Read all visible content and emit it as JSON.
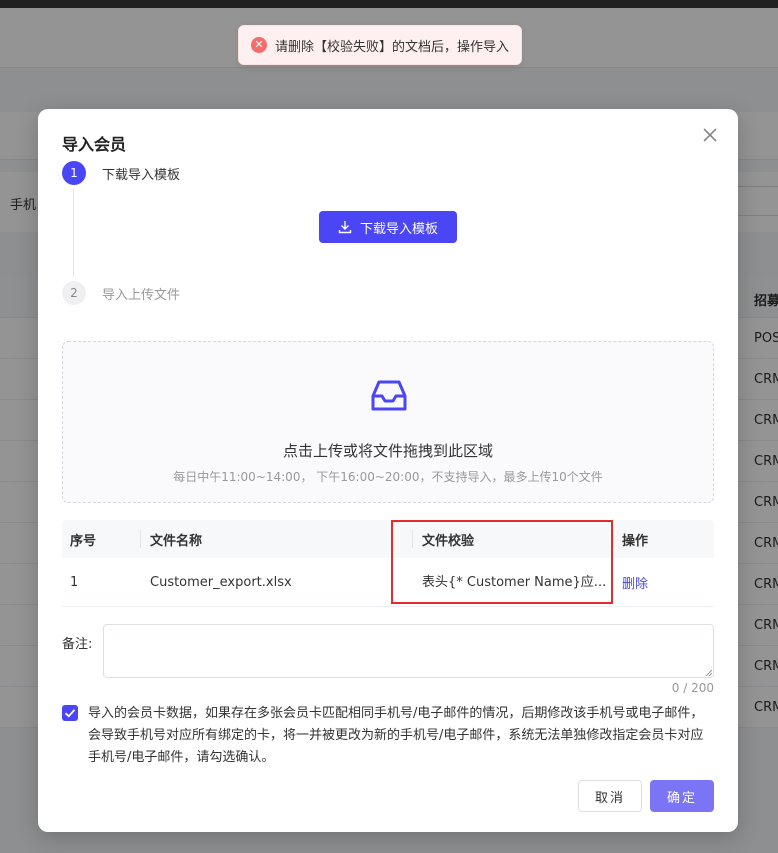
{
  "toast": {
    "icon": "error-circle-icon",
    "message": "请删除【校验失败】的文档后，操作导入"
  },
  "background": {
    "filter_label": "手机",
    "column_header": "招募",
    "rows": [
      "POS",
      "CRM",
      "CRM",
      "CRM",
      "CRM",
      "CRM",
      "CRM",
      "CRM",
      "CRM",
      "CRM"
    ]
  },
  "dialog": {
    "title": "导入会员",
    "steps": [
      {
        "number": "1",
        "label": "下载导入模板"
      },
      {
        "number": "2",
        "label": "导入上传文件"
      }
    ],
    "download_button": "下载导入模板",
    "upload": {
      "title": "点击上传或将文件拖拽到此区域",
      "hint": "每日中午11:00~14:00， 下午16:00~20:00，不支持导入，最多上传10个文件"
    },
    "table": {
      "headers": [
        "序号",
        "文件名称",
        "文件校验",
        "操作"
      ],
      "rows": [
        {
          "index": "1",
          "filename": "Customer_export.xlsx",
          "verify": "表头{* Customer Name}应...",
          "action": "删除"
        }
      ]
    },
    "remark": {
      "label": "备注:",
      "value": "",
      "placeholder": "",
      "counter": "0 / 200"
    },
    "agree": {
      "checked": true,
      "text": "导入的会员卡数据，如果存在多张会员卡匹配相同手机号/电子邮件的情况，后期修改该手机号或电子邮件，会导致手机号对应所有绑定的卡，将一并被更改为新的手机号/电子邮件，系统无法单独修改指定会员卡对应手机号/电子邮件，请勾选确认。"
    },
    "buttons": {
      "cancel": "取消",
      "ok": "确定"
    }
  },
  "colors": {
    "primary": "#4a45f5",
    "confirm": "#7b75f6",
    "error": "#f56c6c",
    "highlight_box": "#e52b2b"
  }
}
